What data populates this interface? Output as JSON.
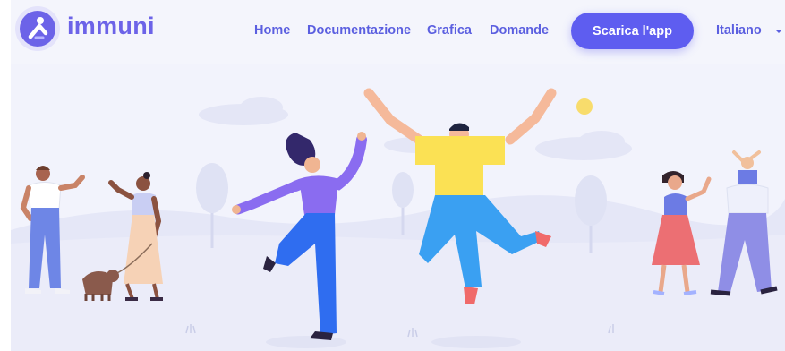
{
  "brand": {
    "name": "immuni"
  },
  "nav": {
    "items": [
      {
        "label": "Home"
      },
      {
        "label": "Documentazione"
      },
      {
        "label": "Grafica"
      },
      {
        "label": "Domande"
      }
    ],
    "cta_label": "Scarica l'app",
    "language": "Italiano"
  },
  "icons": {
    "logo": "immuni-logo",
    "language_caret": "caret-down-icon"
  },
  "colors": {
    "accent": "#5e5df0",
    "nav_text": "#5b5fe0",
    "background": "#f1f2fb",
    "shirt_yellow": "#fbe154",
    "shirt_purple": "#8a6cf0",
    "pants_blue": "#2f6df0"
  }
}
